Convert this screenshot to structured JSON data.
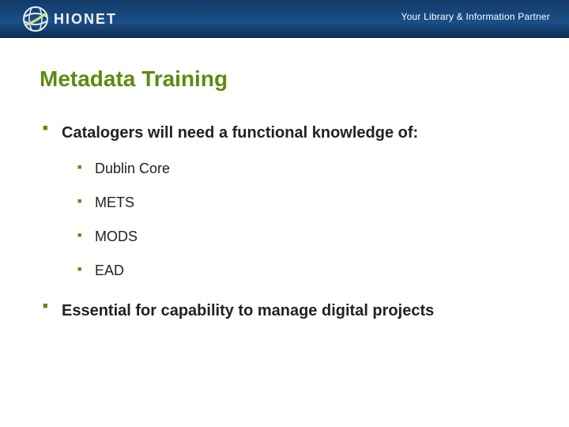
{
  "header": {
    "brand": "HIONET",
    "tagline": "Your Library & Information Partner"
  },
  "title": "Metadata Training",
  "bullets": [
    {
      "text": "Catalogers will need a functional knowledge of:",
      "sub": [
        {
          "text": "Dublin Core"
        },
        {
          "text": "METS"
        },
        {
          "text": "MODS"
        },
        {
          "text": "EAD"
        }
      ]
    },
    {
      "text": "Essential for capability to manage digital projects",
      "sub": []
    }
  ]
}
